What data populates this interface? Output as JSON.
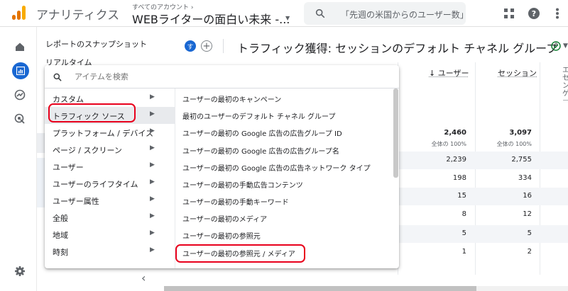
{
  "header": {
    "app_title": "アナリティクス",
    "account_crumb": "すべてのアカウント ›",
    "property_title": "WEBライターの面白い未来 -...",
    "search_placeholder": "「先週の米国からのユーザー数」",
    "icons": [
      "apps-grid-icon",
      "help-icon",
      "more-vert-icon"
    ],
    "logo_colors": [
      "#f9ab00",
      "#e37400",
      "#e37400"
    ]
  },
  "rail": {
    "items": [
      "home-icon",
      "reports-icon",
      "explore-icon",
      "advertising-icon"
    ],
    "footer": "settings-icon",
    "accent": "#1967d2"
  },
  "nav": {
    "items": [
      "レポートのスナップショット",
      "リアルタイム"
    ]
  },
  "report": {
    "badge_letter": "す",
    "add_symbol": "+",
    "title": "トラフィック獲得: セッションのデフォルト チャネル グループ",
    "columns": [
      "↓ ユーザー",
      "セッション"
    ],
    "col3_fragment": "エ\nセ\nン\nゲ\nー\nジ",
    "totals": {
      "users": "2,460",
      "sessions": "3,097",
      "users_sub": "全体の 100%",
      "sessions_sub": "全体の 100%"
    },
    "rows": [
      {
        "users": "2,239",
        "sessions": "2,755"
      },
      {
        "users": "198",
        "sessions": "334"
      },
      {
        "users": "15",
        "sessions": "16"
      },
      {
        "users": "8",
        "sessions": "12"
      },
      {
        "users": "5",
        "sessions": "5"
      },
      {
        "users": "1",
        "sessions": "2"
      }
    ]
  },
  "menu": {
    "search_placeholder": "アイテムを検索",
    "categories": [
      {
        "label": "カスタム",
        "selected": false
      },
      {
        "label": "トラフィック ソース",
        "selected": true
      },
      {
        "label": "プラットフォーム / デバイス",
        "selected": false
      },
      {
        "label": "ページ / スクリーン",
        "selected": false
      },
      {
        "label": "ユーザー",
        "selected": false
      },
      {
        "label": "ユーザーのライフタイム",
        "selected": false
      },
      {
        "label": "ユーザー属性",
        "selected": false
      },
      {
        "label": "全般",
        "selected": false
      },
      {
        "label": "地域",
        "selected": false
      },
      {
        "label": "時刻",
        "selected": false
      }
    ],
    "options": [
      "ユーザーの最初のキャンペーン",
      "最初のユーザーのデフォルト チャネル グループ",
      "ユーザーの最初の Google 広告の広告グループ ID",
      "ユーザーの最初の Google 広告の広告グループ名",
      "ユーザーの最初の Google 広告の広告ネットワーク タイプ",
      "ユーザーの最初の手動広告コンテンツ",
      "ユーザーの最初の手動キーワード",
      "ユーザーの最初のメディア",
      "ユーザーの最初の参照元",
      "ユーザーの最初の参照元 / メディア"
    ],
    "highlight_color": "#e8001c"
  },
  "footer": {
    "collapse_symbol": "‹"
  }
}
